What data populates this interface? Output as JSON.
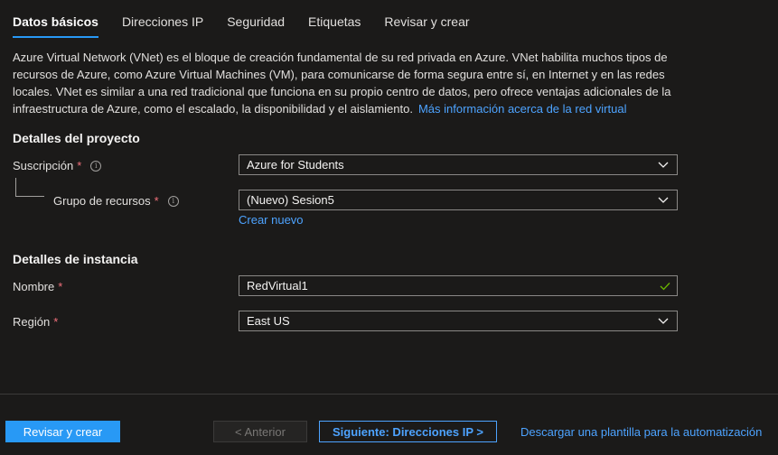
{
  "tabs": [
    {
      "label": "Datos básicos",
      "active": true
    },
    {
      "label": "Direcciones IP",
      "active": false
    },
    {
      "label": "Seguridad",
      "active": false
    },
    {
      "label": "Etiquetas",
      "active": false
    },
    {
      "label": "Revisar y crear",
      "active": false
    }
  ],
  "description": {
    "text": "Azure Virtual Network (VNet) es el bloque de creación fundamental de su red privada en Azure. VNet habilita muchos tipos de recursos de Azure, como Azure Virtual Machines (VM), para comunicarse de forma segura entre sí, en Internet y en las redes locales. VNet es similar a una red tradicional que funciona en su propio centro de datos, pero ofrece ventajas adicionales de la infraestructura de Azure, como el escalado, la disponibilidad y el aislamiento.",
    "link": "Más información acerca de la red virtual"
  },
  "project": {
    "heading": "Detalles del proyecto",
    "subscription_label": "Suscripción",
    "subscription_value": "Azure for Students",
    "resource_group_label": "Grupo de recursos",
    "resource_group_value": "(Nuevo) Sesion5",
    "create_new": "Crear nuevo"
  },
  "instance": {
    "heading": "Detalles de instancia",
    "name_label": "Nombre",
    "name_value": "RedVirtual1",
    "region_label": "Región",
    "region_value": "East US"
  },
  "required_mark": "*",
  "info_glyph": "i",
  "footer": {
    "review_create": "Revisar y crear",
    "previous": "< Anterior",
    "next": "Siguiente: Direcciones IP >",
    "download_template": "Descargar una plantilla para la automatización"
  },
  "colors": {
    "accent": "#2899f5",
    "link": "#4da3ff",
    "required": "#f1707b",
    "valid_check": "#6bb700",
    "background": "#1b1a19"
  }
}
